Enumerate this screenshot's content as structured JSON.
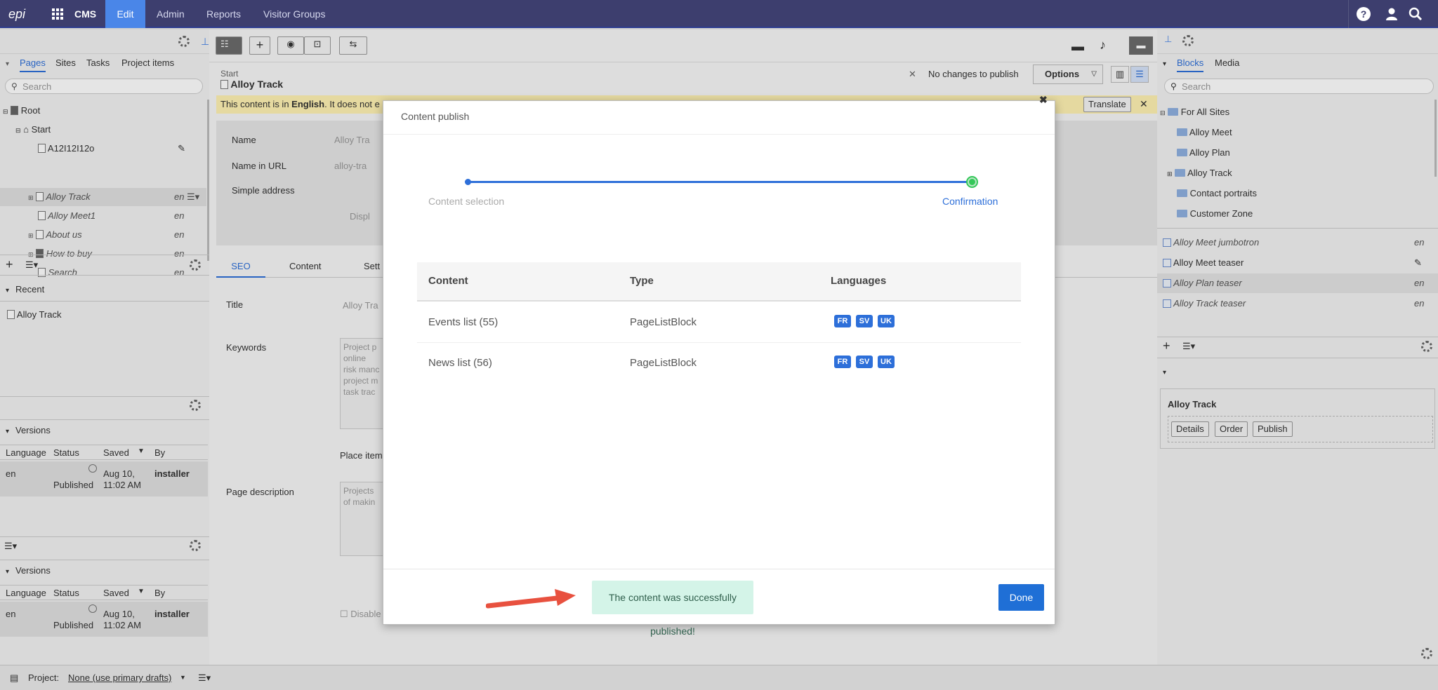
{
  "topbar": {
    "logo": "epi",
    "cms": "CMS",
    "nav": [
      "Edit",
      "Admin",
      "Reports",
      "Visitor Groups"
    ]
  },
  "left": {
    "tabs": [
      "Pages",
      "Sites",
      "Tasks",
      "Project items"
    ],
    "search_placeholder": "Search",
    "tree": [
      {
        "label": "Root",
        "lang": ""
      },
      {
        "label": "Start",
        "lang": ""
      },
      {
        "label": "A12I12I12o",
        "lang": ""
      },
      {
        "label": "Alloy Track",
        "lang": "en"
      },
      {
        "label": "Alloy Meet1",
        "lang": "en"
      },
      {
        "label": "About us",
        "lang": "en"
      },
      {
        "label": "How to buy",
        "lang": "en"
      },
      {
        "label": "Search",
        "lang": "en"
      }
    ],
    "recent_title": "Recent",
    "recent_item": "Alloy Track",
    "versions_title": "Versions",
    "versions_cols": [
      "Language",
      "Status",
      "Saved",
      "By"
    ],
    "versions_row": {
      "lang": "en",
      "status": "Published",
      "saved1": "Aug 10,",
      "saved2": "11:02 AM",
      "by": "installer"
    }
  },
  "editor": {
    "breadcrumb": "Start",
    "title": "Alloy Track",
    "no_changes": "No changes to publish",
    "options": "Options",
    "notice_pre": "This content is in ",
    "notice_lang": "English",
    "notice_post": ". It does not e",
    "translate": "Translate",
    "fields": {
      "name": "Name",
      "name_val": "Alloy Tra",
      "url": "Name in URL",
      "url_val": "alloy-tra",
      "simple": "Simple address",
      "display": "Displ"
    },
    "tabs": [
      "SEO",
      "Content",
      "Sett"
    ],
    "title_label": "Title",
    "title_val": "Alloy Tra",
    "keywords_label": "Keywords",
    "keywords_val": [
      "Project p",
      "online",
      "risk manc",
      "project m",
      "task trac"
    ],
    "place_item": "Place item",
    "pagedesc_label": "Page description",
    "pagedesc_val": [
      "Projects",
      "of makin"
    ],
    "disable": "Disable"
  },
  "right": {
    "tabs": [
      "Blocks",
      "Media"
    ],
    "search_placeholder": "Search",
    "tree": [
      "For All Sites",
      "Alloy Meet",
      "Alloy Plan",
      "Alloy Track",
      "Contact portraits",
      "Customer Zone"
    ],
    "blocks": [
      {
        "label": "Alloy Meet jumbotron",
        "lang": "en"
      },
      {
        "label": "Alloy Meet teaser",
        "lang": ""
      },
      {
        "label": "Alloy Plan teaser",
        "lang": "en"
      },
      {
        "label": "Alloy Track teaser",
        "lang": "en"
      }
    ],
    "card_title": "Alloy Track",
    "card_buttons": [
      "Details",
      "Order",
      "Publish"
    ]
  },
  "modal": {
    "title": "Content publish",
    "steps": [
      "Content selection",
      "Confirmation"
    ],
    "cols": [
      "Content",
      "Type",
      "Languages"
    ],
    "rows": [
      {
        "content": "Events list (55)",
        "type": "PageListBlock",
        "langs": [
          "FR",
          "SV",
          "UK"
        ]
      },
      {
        "content": "News list (56)",
        "type": "PageListBlock",
        "langs": [
          "FR",
          "SV",
          "UK"
        ]
      }
    ],
    "success": "The content was successfully published!",
    "done": "Done",
    "colors": {
      "accent": "#2d6fd9",
      "success_bg": "#d4f4e8",
      "arrow": "#e8513f",
      "step_done": "#34c759"
    }
  },
  "bottom": {
    "project_label": "Project:",
    "project_value": "None (use primary drafts)"
  }
}
